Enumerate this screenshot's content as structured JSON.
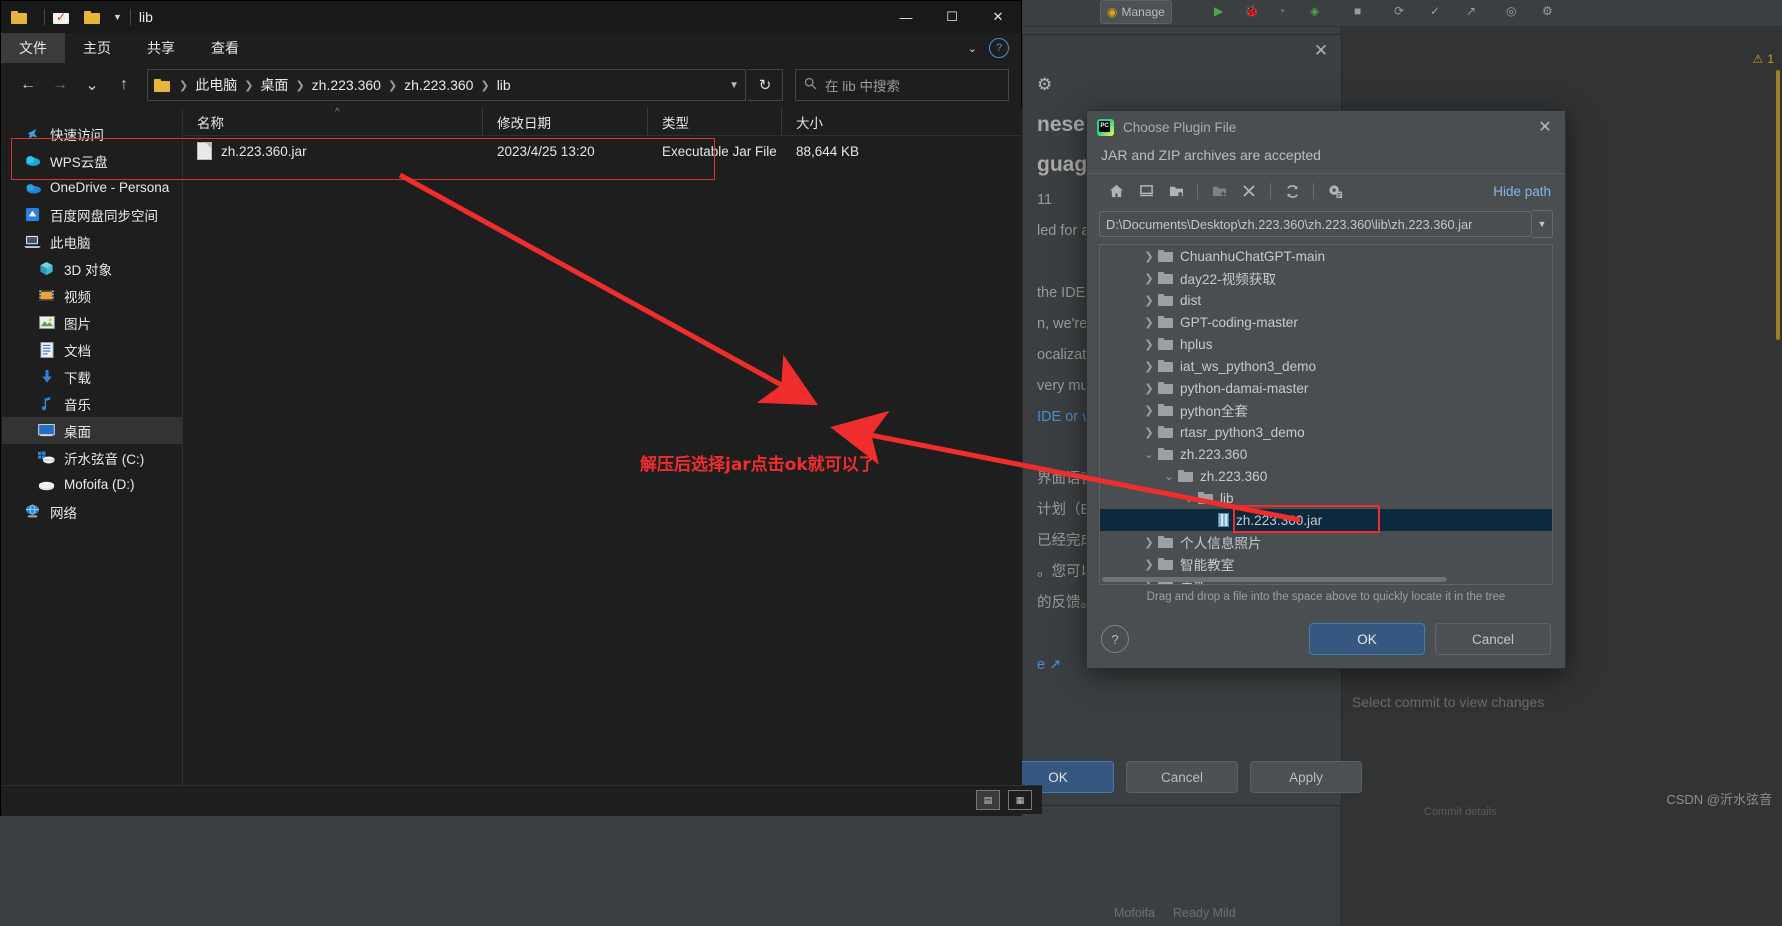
{
  "explorer": {
    "title": "lib",
    "quick_access_icons": [
      "folder-icon",
      "checklist-icon",
      "folder-icon",
      "dropdown-caret-icon"
    ],
    "window_buttons": {
      "minimize": "—",
      "maximize": "☐",
      "close": "✕"
    },
    "ribbon_tabs": [
      {
        "label": "文件",
        "active": true
      },
      {
        "label": "主页",
        "active": false
      },
      {
        "label": "共享",
        "active": false
      },
      {
        "label": "查看",
        "active": false
      }
    ],
    "ribbon_help": "?",
    "nav": {
      "back": "←",
      "forward": "→",
      "recent": "⌄",
      "up": "↑",
      "refresh": "↻"
    },
    "breadcrumb": [
      "此电脑",
      "桌面",
      "zh.223.360",
      "zh.223.360",
      "lib"
    ],
    "search_placeholder": "在 lib 中搜索",
    "sidebar": [
      {
        "label": "快速访问",
        "icon": "pin-star-icon",
        "indent": false,
        "selected": false
      },
      {
        "label": "WPS云盘",
        "icon": "cloud-icon",
        "indent": false,
        "selected": false
      },
      {
        "label": "OneDrive - Persona",
        "icon": "onedrive-icon",
        "indent": false,
        "selected": false
      },
      {
        "label": "百度网盘同步空间",
        "icon": "baidu-disk-icon",
        "indent": false,
        "selected": false
      },
      {
        "label": "此电脑",
        "icon": "this-pc-icon",
        "indent": false,
        "selected": false
      },
      {
        "label": "3D 对象",
        "icon": "cube-icon",
        "indent": true,
        "selected": false
      },
      {
        "label": "视频",
        "icon": "video-icon",
        "indent": true,
        "selected": false
      },
      {
        "label": "图片",
        "icon": "picture-icon",
        "indent": true,
        "selected": false
      },
      {
        "label": "文档",
        "icon": "document-icon",
        "indent": true,
        "selected": false
      },
      {
        "label": "下载",
        "icon": "download-icon",
        "indent": true,
        "selected": false
      },
      {
        "label": "音乐",
        "icon": "music-note-icon",
        "indent": true,
        "selected": false
      },
      {
        "label": "桌面",
        "icon": "desktop-icon",
        "indent": true,
        "selected": true
      },
      {
        "label": "沂水弦音 (C:)",
        "icon": "windows-drive-icon",
        "indent": true,
        "selected": false
      },
      {
        "label": "Mofoifa (D:)",
        "icon": "drive-icon",
        "indent": true,
        "selected": false
      },
      {
        "label": "网络",
        "icon": "network-icon",
        "indent": false,
        "selected": false
      }
    ],
    "columns": [
      "名称",
      "修改日期",
      "类型",
      "大小"
    ],
    "rows": [
      {
        "name": "zh.223.360.jar",
        "modified": "2023/4/25 13:20",
        "type": "Executable Jar File",
        "size": "88,644 KB"
      }
    ]
  },
  "settings": {
    "close": "✕",
    "gear_icon": "gear-icon",
    "lines": [
      "nese (S",
      "guage",
      "11",
      "led for all",
      "the IDE in",
      "n, we're n",
      "ocalizatio",
      "very muc",
      "IDE or via",
      "界面语言。",
      "计划（EAP",
      "已经完成。",
      "。您可以直",
      "的反馈。",
      "e ↗"
    ],
    "buttons": {
      "ok": "OK",
      "cancel": "Cancel",
      "apply": "Apply"
    }
  },
  "plugin_dialog": {
    "title": "Choose Plugin File",
    "app_icon": "pycharm-icon",
    "close_icon": "close-icon",
    "subtitle": "JAR and ZIP archives are accepted",
    "toolbar_icons": [
      "home-icon",
      "desktop-icon",
      "project-folder-icon",
      "new-folder-icon",
      "delete-icon",
      "refresh-icon",
      "show-hidden-icon"
    ],
    "hide_path_label": "Hide path",
    "path_value": "D:\\Documents\\Desktop\\zh.223.360\\zh.223.360\\lib\\zh.223.360.jar",
    "path_dropdown_icon": "chevron-down-icon",
    "tree": [
      {
        "label": "ChuanhuChatGPT-main",
        "depth": 1,
        "state": "collapsed",
        "kind": "folder",
        "selected": false
      },
      {
        "label": "day22-视频获取",
        "depth": 1,
        "state": "collapsed",
        "kind": "folder",
        "selected": false
      },
      {
        "label": "dist",
        "depth": 1,
        "state": "collapsed",
        "kind": "folder",
        "selected": false
      },
      {
        "label": "GPT-coding-master",
        "depth": 1,
        "state": "collapsed",
        "kind": "folder",
        "selected": false
      },
      {
        "label": "hplus",
        "depth": 1,
        "state": "collapsed",
        "kind": "folder",
        "selected": false
      },
      {
        "label": "iat_ws_python3_demo",
        "depth": 1,
        "state": "collapsed",
        "kind": "folder",
        "selected": false
      },
      {
        "label": "python-damai-master",
        "depth": 1,
        "state": "collapsed",
        "kind": "folder",
        "selected": false
      },
      {
        "label": "python全套",
        "depth": 1,
        "state": "collapsed",
        "kind": "folder",
        "selected": false
      },
      {
        "label": "rtasr_python3_demo",
        "depth": 1,
        "state": "collapsed",
        "kind": "folder",
        "selected": false
      },
      {
        "label": "zh.223.360",
        "depth": 1,
        "state": "expanded",
        "kind": "folder",
        "selected": false
      },
      {
        "label": "zh.223.360",
        "depth": 2,
        "state": "expanded",
        "kind": "folder",
        "selected": false
      },
      {
        "label": "lib",
        "depth": 3,
        "state": "expanded",
        "kind": "folder",
        "selected": false
      },
      {
        "label": "zh.223.360.jar",
        "depth": 4,
        "state": "leaf",
        "kind": "jar",
        "selected": true
      },
      {
        "label": "个人信息照片",
        "depth": 1,
        "state": "collapsed",
        "kind": "folder",
        "selected": false
      },
      {
        "label": "智能教室",
        "depth": 1,
        "state": "collapsed",
        "kind": "folder",
        "selected": false
      },
      {
        "label": "更新",
        "depth": 1,
        "state": "collapsed",
        "kind": "folder",
        "selected": false
      }
    ],
    "drag_hint": "Drag and drop a file into the space above to quickly locate it in the tree",
    "help_label": "?",
    "ok_label": "OK",
    "cancel_label": "Cancel"
  },
  "annotation": {
    "text": "解压后选择jar点击ok就可以了",
    "color": "#ef2d2d"
  },
  "ide": {
    "manage_label": "Manage",
    "warning_count": "1",
    "commit_placeholder": "Select commit to view changes",
    "commit_details": "Commit details",
    "watermark": "CSDN @沂水弦音"
  }
}
